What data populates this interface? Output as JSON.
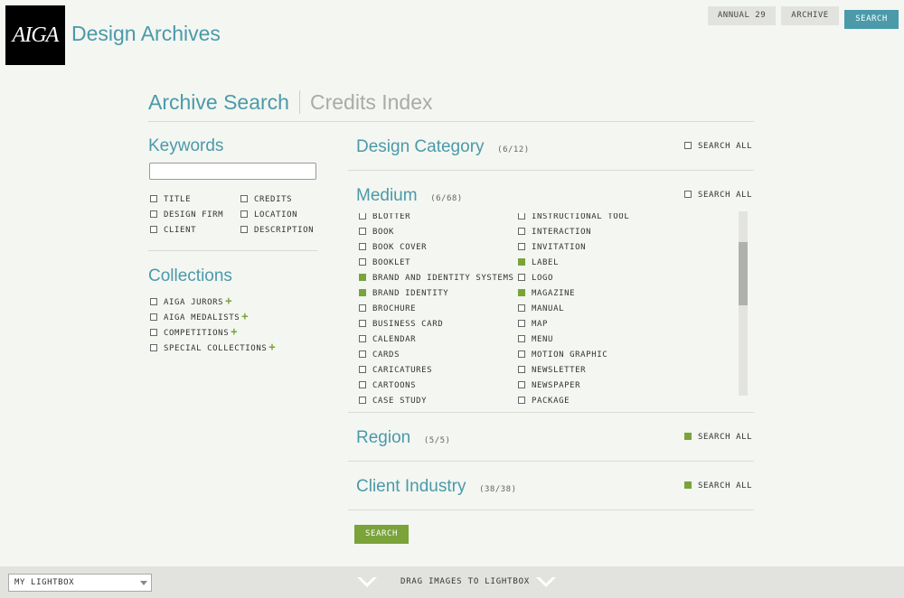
{
  "header": {
    "logo_text": "AIGA",
    "site_title": "Design Archives",
    "buttons": {
      "annual": "ANNUAL 29",
      "archive": "ARCHIVE",
      "search": "SEARCH"
    }
  },
  "tabs": {
    "archive_search": "Archive Search",
    "credits_index": "Credits Index"
  },
  "keywords": {
    "heading": "Keywords",
    "input_value": "",
    "options": [
      {
        "label": "TITLE",
        "checked": false
      },
      {
        "label": "CREDITS",
        "checked": false
      },
      {
        "label": "DESIGN FIRM",
        "checked": false
      },
      {
        "label": "LOCATION",
        "checked": false
      },
      {
        "label": "CLIENT",
        "checked": false
      },
      {
        "label": "DESCRIPTION",
        "checked": false
      }
    ]
  },
  "collections": {
    "heading": "Collections",
    "items": [
      {
        "label": "AIGA JURORS",
        "plus": "+"
      },
      {
        "label": "AIGA MEDALISTS",
        "plus": "+"
      },
      {
        "label": "COMPETITIONS",
        "plus": "+"
      },
      {
        "label": "SPECIAL COLLECTIONS",
        "plus": "+"
      }
    ]
  },
  "design_category": {
    "title": "Design Category",
    "count": "(6/12)",
    "search_all": "SEARCH ALL",
    "search_all_checked": false
  },
  "medium": {
    "title": "Medium",
    "count": "(6/68)",
    "search_all": "SEARCH ALL",
    "search_all_checked": false,
    "left": [
      {
        "label": "BLOTTER",
        "checked": false
      },
      {
        "label": "BOOK",
        "checked": false
      },
      {
        "label": "BOOK COVER",
        "checked": false
      },
      {
        "label": "BOOKLET",
        "checked": false
      },
      {
        "label": "BRAND AND IDENTITY SYSTEMS",
        "checked": true
      },
      {
        "label": "BRAND IDENTITY",
        "checked": true
      },
      {
        "label": "BROCHURE",
        "checked": false
      },
      {
        "label": "BUSINESS CARD",
        "checked": false
      },
      {
        "label": "CALENDAR",
        "checked": false
      },
      {
        "label": "CARDS",
        "checked": false
      },
      {
        "label": "CARICATURES",
        "checked": false
      },
      {
        "label": "CARTOONS",
        "checked": false
      },
      {
        "label": "CASE STUDY",
        "checked": false
      }
    ],
    "right": [
      {
        "label": "INSTRUCTIONAL TOOL",
        "checked": false
      },
      {
        "label": "INTERACTION",
        "checked": false
      },
      {
        "label": "INVITATION",
        "checked": false
      },
      {
        "label": "LABEL",
        "checked": true
      },
      {
        "label": "LOGO",
        "checked": false
      },
      {
        "label": "MAGAZINE",
        "checked": true
      },
      {
        "label": "MANUAL",
        "checked": false
      },
      {
        "label": "MAP",
        "checked": false
      },
      {
        "label": "MENU",
        "checked": false
      },
      {
        "label": "MOTION GRAPHIC",
        "checked": false
      },
      {
        "label": "NEWSLETTER",
        "checked": false
      },
      {
        "label": "NEWSPAPER",
        "checked": false
      },
      {
        "label": "PACKAGE",
        "checked": false
      }
    ],
    "scroll_position": 0.25
  },
  "region": {
    "title": "Region",
    "count": "(5/5)",
    "search_all": "SEARCH ALL",
    "search_all_checked": true
  },
  "client_industry": {
    "title": "Client Industry",
    "count": "(38/38)",
    "search_all": "SEARCH ALL",
    "search_all_checked": true
  },
  "search_button": "SEARCH",
  "footer": {
    "lightbox_select": "MY LIGHTBOX",
    "drag_text": "DRAG IMAGES TO LIGHTBOX"
  },
  "colors": {
    "teal": "#4a9aaa",
    "green": "#7aa33a"
  }
}
